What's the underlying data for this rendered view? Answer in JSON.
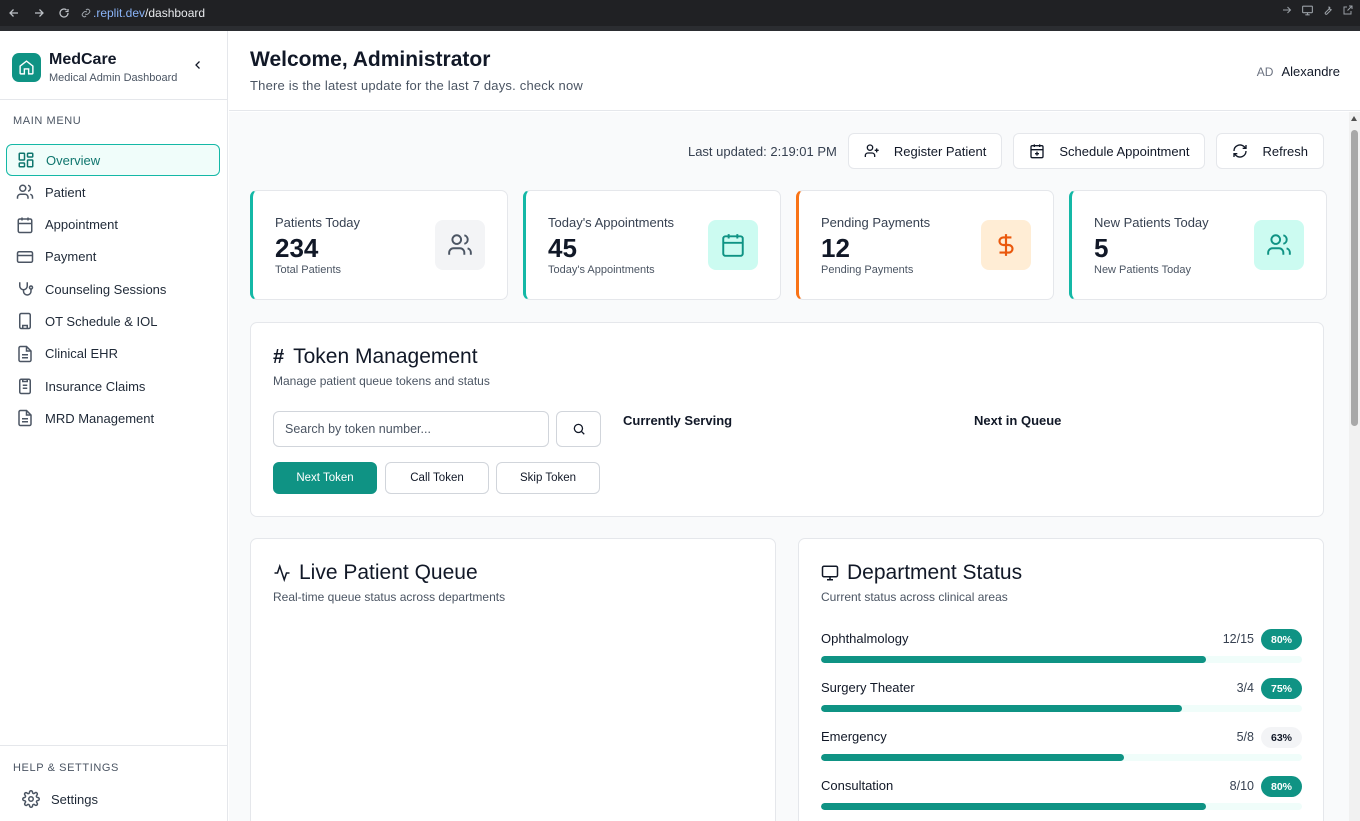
{
  "browser": {
    "url_domain": ".replit.dev",
    "url_path": "/dashboard"
  },
  "sidebar": {
    "brand_name": "MedCare",
    "brand_subtitle": "Medical Admin Dashboard",
    "main_menu_label": "MAIN MENU",
    "help_label": "HELP & SETTINGS",
    "settings_label": "Settings",
    "items": [
      {
        "label": "Overview",
        "icon": "grid-icon",
        "active": true
      },
      {
        "label": "Patient",
        "icon": "users-icon"
      },
      {
        "label": "Appointment",
        "icon": "calendar-icon"
      },
      {
        "label": "Payment",
        "icon": "credit-card-icon"
      },
      {
        "label": "Counseling Sessions",
        "icon": "stethoscope-icon"
      },
      {
        "label": "OT Schedule & IOL",
        "icon": "building-icon"
      },
      {
        "label": "Clinical EHR",
        "icon": "file-text-icon"
      },
      {
        "label": "Insurance Claims",
        "icon": "clipboard-icon"
      },
      {
        "label": "MRD Management",
        "icon": "file-text-icon"
      }
    ]
  },
  "header": {
    "title": "Welcome, Administrator",
    "subtitle": "There is the latest update for the last 7 days. check now",
    "avatar_initials": "AD",
    "user_name": "Alexandre"
  },
  "toolbar": {
    "last_updated": "Last updated: 2:19:01 PM",
    "register_label": "Register Patient",
    "schedule_label": "Schedule Appointment",
    "refresh_label": "Refresh"
  },
  "stats": [
    {
      "title": "Patients Today",
      "value": "234",
      "sub": "Total Patients",
      "icon": "users-icon",
      "accent": "#14b8a6"
    },
    {
      "title": "Today's Appointments",
      "value": "45",
      "sub": "Today's Appointments",
      "icon": "calendar-icon",
      "accent": "#14b8a6"
    },
    {
      "title": "Pending Payments",
      "value": "12",
      "sub": "Pending Payments",
      "icon": "dollar-icon",
      "accent": "#f97316"
    },
    {
      "title": "New Patients Today",
      "value": "5",
      "sub": "New Patients Today",
      "icon": "users-icon",
      "accent": "#14b8a6"
    }
  ],
  "token": {
    "title": "Token Management",
    "subtitle": "Manage patient queue tokens and status",
    "search_placeholder": "Search by token number...",
    "next_label": "Next Token",
    "call_label": "Call Token",
    "skip_label": "Skip Token",
    "currently_serving_label": "Currently Serving",
    "next_in_queue_label": "Next in Queue"
  },
  "queue": {
    "title": "Live Patient Queue",
    "subtitle": "Real-time queue status across departments"
  },
  "departments": {
    "title": "Department Status",
    "subtitle": "Current status across clinical areas",
    "items": [
      {
        "name": "Ophthalmology",
        "count": "12/15",
        "percent": "80%",
        "fill": 0.8
      },
      {
        "name": "Surgery Theater",
        "count": "3/4",
        "percent": "75%",
        "fill": 0.75
      },
      {
        "name": "Emergency",
        "count": "5/8",
        "percent": "63%",
        "fill": 0.63
      },
      {
        "name": "Consultation",
        "count": "8/10",
        "percent": "80%",
        "fill": 0.8
      }
    ]
  },
  "colors": {
    "primary": "#0f9384",
    "accent_teal": "#14b8a6",
    "accent_orange": "#f97316"
  }
}
